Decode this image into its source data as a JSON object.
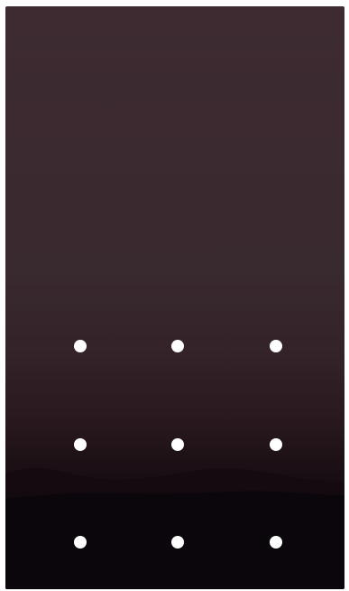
{
  "lock_screen": {
    "type": "pattern-unlock",
    "pattern_grid": {
      "rows": 3,
      "columns": 3,
      "selected_nodes": []
    }
  },
  "colors": {
    "dot": "#ffffff",
    "background_top": "#3e2b32",
    "background_bottom": "#0c070c"
  }
}
